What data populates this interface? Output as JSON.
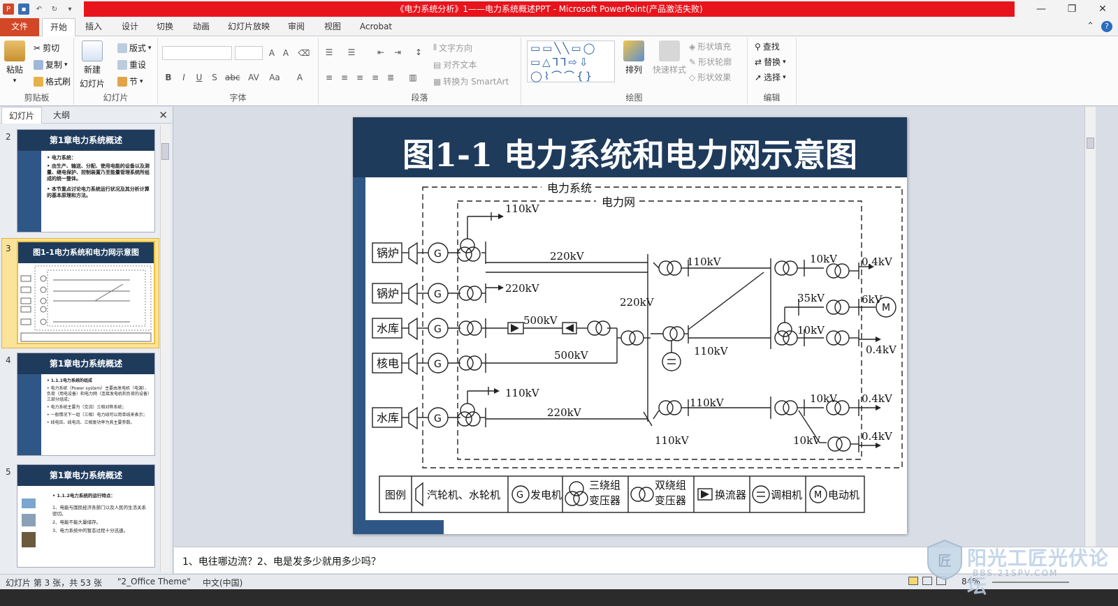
{
  "window": {
    "title": "《电力系统分析》1——电力系统概述PPT - Microsoft PowerPoint(产品激活失败)"
  },
  "tabs": {
    "file": "文件",
    "items": [
      "开始",
      "插入",
      "设计",
      "切换",
      "动画",
      "幻灯片放映",
      "审阅",
      "视图",
      "Acrobat"
    ]
  },
  "ribbon": {
    "clipboard": {
      "paste": "粘贴",
      "cut": "剪切",
      "copy": "复制",
      "format_painter": "格式刷",
      "label": "剪贴板"
    },
    "slides": {
      "new_slide": "新建",
      "new_slide2": "幻灯片",
      "layout": "版式",
      "reset": "重设",
      "section": "节",
      "label": "幻灯片"
    },
    "font": {
      "label": "字体"
    },
    "paragraph": {
      "text_direction": "文字方向",
      "align_text": "对齐文本",
      "smartart": "转换为 SmartArt",
      "label": "段落"
    },
    "drawing": {
      "arrange": "排列",
      "quick_styles": "快速样式",
      "shape_fill": "形状填充",
      "shape_outline": "形状轮廓",
      "shape_effects": "形状效果",
      "label": "绘图"
    },
    "editing": {
      "find": "查找",
      "replace": "替换",
      "select": "选择",
      "label": "编辑"
    }
  },
  "left_panel": {
    "tab_slides": "幻灯片",
    "tab_outline": "大纲",
    "thumbs": [
      {
        "num": "2",
        "title": "第1章电力系统概述",
        "lines": [
          "• 电力系统：",
          "• 由生产、输送、分配、使用电能的设备以及测量、继电保护、控制装置乃至能量管理系统所组成的统一整体。",
          "• 本节重点讨论电力系统运行状况及其分析计算的基本原理和方法。"
        ]
      },
      {
        "num": "3",
        "title": "图1-1电力系统和电力网示意图"
      },
      {
        "num": "4",
        "title": "第1章电力系统概述",
        "lines": [
          "• 1.1.1电力系统的组成",
          "• 电力系统（Power system）主要由发电机（电源）、负荷（用电设备）和电力网（连接发电机和负荷的设备）三部分组成；",
          "• 电力系统主要为（交流）三相对称系统；",
          "• 一般情况下一组（三相）电力线可以用单线来表示；",
          "• 线电压、线电流、三相复功率为其主要参数。"
        ]
      },
      {
        "num": "5",
        "title": "第1章电力系统概述",
        "lines": [
          "• 1.1.2电力系统的运行特点：",
          "1、电能与国民经济各部门以及人民的生活关系密切。",
          "2、电能不能大量储存。",
          "3、电力系统中的暂态过程十分迅速。"
        ]
      }
    ]
  },
  "slide": {
    "title": "图1-1 电力系统和电力网示意图",
    "diagram": {
      "outer_label": "电力系统",
      "inner_label": "电力网",
      "sources": [
        "锅炉",
        "锅炉",
        "水库",
        "核电",
        "水库"
      ],
      "gen": "G",
      "motor": "M",
      "voltages": {
        "v110_top": "110kV",
        "v220_a": "220kV",
        "v220_b": "220kV",
        "v500_a": "500kV",
        "v500_b": "500kV",
        "v220_c": "220kV",
        "v110_a": "110kV",
        "v10_a": "10kV",
        "v04_a": "0.4kV",
        "v35": "35kV",
        "v6": "6kV",
        "v10_b": "10kV",
        "v04_b": "0.4kV",
        "v110_b": "110kV",
        "v110_c": "110kV",
        "v220_d": "220kV",
        "v110_d": "110kV",
        "v110_e": "110kV",
        "v10_c": "10kV",
        "v04_c": "0.4kV",
        "v10_d": "10kV",
        "v04_d": "0.4kV"
      },
      "legend": {
        "title": "图例",
        "turbine": "汽轮机、水轮机",
        "generator": "发电机",
        "three_winding_1": "三绕组",
        "three_winding_2": "变压器",
        "two_winding_1": "双绕组",
        "two_winding_2": "变压器",
        "converter": "换流器",
        "condenser": "调相机",
        "motor": "电动机"
      }
    }
  },
  "notes": {
    "text": "1、电往哪边流？2、电是发多少就用多少吗？"
  },
  "status": {
    "slide_info": "幻灯片 第 3 张，共 53 张",
    "theme": "\"2_Office Theme\"",
    "language": "中文(中国)",
    "zoom": "84%"
  },
  "watermark": {
    "main": "阳光工匠光伏论坛",
    "sub": "BBS.21SPV.COM"
  }
}
